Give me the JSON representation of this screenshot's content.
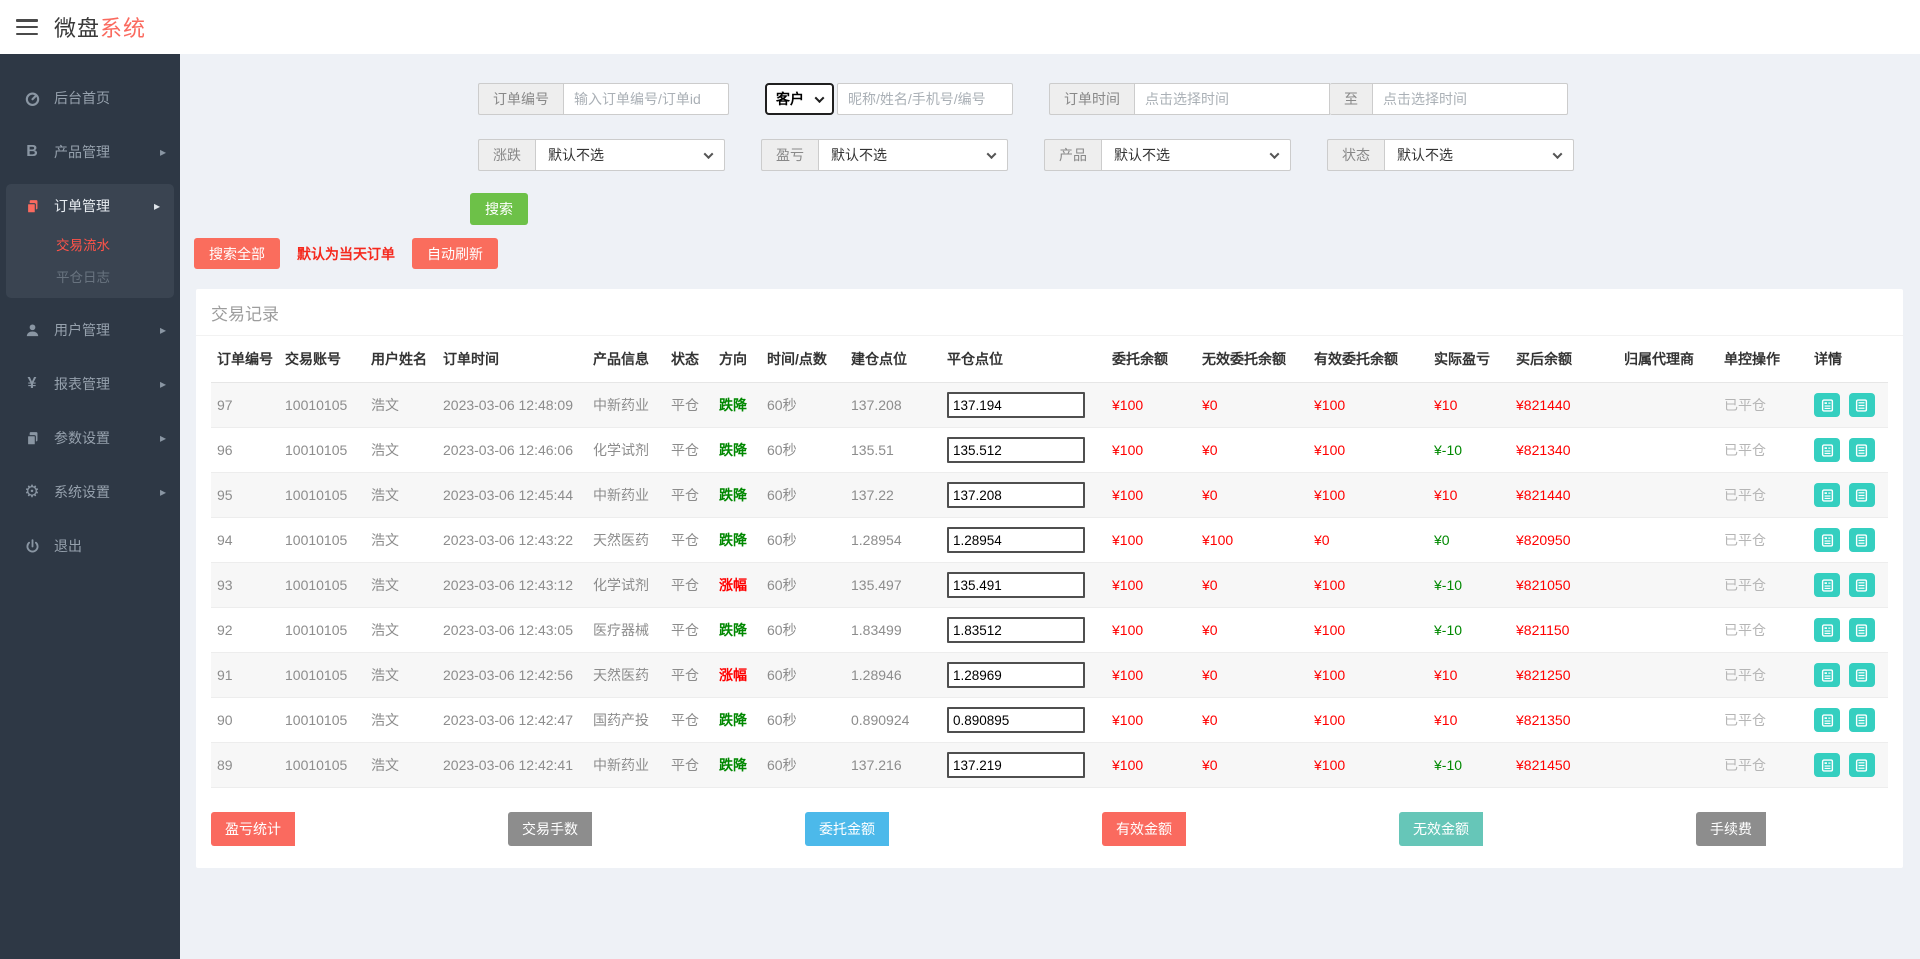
{
  "header": {
    "brand_black": "微盘",
    "brand_red": "系统"
  },
  "sidebar": {
    "home": "后台首页",
    "product": "产品管理",
    "order": "订单管理",
    "flow": "交易流水",
    "log": "平仓日志",
    "user": "用户管理",
    "report": "报表管理",
    "param": "参数设置",
    "system": "系统设置",
    "logout": "退出"
  },
  "filters": {
    "order_no_label": "订单编号",
    "order_no_placeholder": "输入订单编号/订单id",
    "customer_select": "客户",
    "customer_placeholder": "昵称/姓名/手机号/编号",
    "time_label": "订单时间",
    "time_placeholder": "点击选择时间",
    "to_label": "至",
    "time_placeholder2": "点击选择时间",
    "updown_label": "涨跌",
    "updown_value": "默认不选",
    "pl_label": "盈亏",
    "pl_value": "默认不选",
    "product_label": "产品",
    "product_value": "默认不选",
    "status_label": "状态",
    "status_value": "默认不选",
    "search_button": "搜索"
  },
  "actions": {
    "search_all": "搜索全部",
    "note": "默认为当天订单",
    "auto_refresh": "自动刷新"
  },
  "colors": {
    "accent_salmon": "#fa6a5f",
    "search_green": "#6dc148",
    "detail_teal": "#35cfc0",
    "money_red": "#ff0000",
    "money_green": "#008800"
  },
  "table": {
    "title": "交易记录",
    "columns": [
      "订单编号",
      "交易账号",
      "用户姓名",
      "订单时间",
      "产品信息",
      "状态",
      "方向",
      "时间/点数",
      "建仓点位",
      "平仓点位",
      "委托余额",
      "无效委托余额",
      "有效委托余额",
      "实际盈亏",
      "买后余额",
      "归属代理商",
      "单控操作",
      "详情"
    ],
    "rows": [
      {
        "no": "97",
        "account": "10010105",
        "name": "浩文",
        "time": "2023-03-06 12:48:09",
        "product": "中新药业",
        "status": "平仓",
        "direction": "跌降",
        "dir_cls": "green",
        "duration": "60秒",
        "open": "137.208",
        "close": "137.194",
        "entrust": "¥100",
        "invalid": "¥0",
        "valid": "¥100",
        "profit": "¥10",
        "profit_cls": "red",
        "after": "¥821440",
        "agent": "",
        "control": "已平仓"
      },
      {
        "no": "96",
        "account": "10010105",
        "name": "浩文",
        "time": "2023-03-06 12:46:06",
        "product": "化学试剂",
        "status": "平仓",
        "direction": "跌降",
        "dir_cls": "green",
        "duration": "60秒",
        "open": "135.51",
        "close": "135.512",
        "entrust": "¥100",
        "invalid": "¥0",
        "valid": "¥100",
        "profit": "¥-10",
        "profit_cls": "green",
        "after": "¥821340",
        "agent": "",
        "control": "已平仓"
      },
      {
        "no": "95",
        "account": "10010105",
        "name": "浩文",
        "time": "2023-03-06 12:45:44",
        "product": "中新药业",
        "status": "平仓",
        "direction": "跌降",
        "dir_cls": "green",
        "duration": "60秒",
        "open": "137.22",
        "close": "137.208",
        "entrust": "¥100",
        "invalid": "¥0",
        "valid": "¥100",
        "profit": "¥10",
        "profit_cls": "red",
        "after": "¥821440",
        "agent": "",
        "control": "已平仓"
      },
      {
        "no": "94",
        "account": "10010105",
        "name": "浩文",
        "time": "2023-03-06 12:43:22",
        "product": "天然医药",
        "status": "平仓",
        "direction": "跌降",
        "dir_cls": "green",
        "duration": "60秒",
        "open": "1.28954",
        "close": "1.28954",
        "entrust": "¥100",
        "invalid": "¥100",
        "valid": "¥0",
        "profit": "¥0",
        "profit_cls": "green",
        "after": "¥820950",
        "agent": "",
        "control": "已平仓"
      },
      {
        "no": "93",
        "account": "10010105",
        "name": "浩文",
        "time": "2023-03-06 12:43:12",
        "product": "化学试剂",
        "status": "平仓",
        "direction": "涨幅",
        "dir_cls": "red",
        "duration": "60秒",
        "open": "135.497",
        "close": "135.491",
        "entrust": "¥100",
        "invalid": "¥0",
        "valid": "¥100",
        "profit": "¥-10",
        "profit_cls": "green",
        "after": "¥821050",
        "agent": "",
        "control": "已平仓"
      },
      {
        "no": "92",
        "account": "10010105",
        "name": "浩文",
        "time": "2023-03-06 12:43:05",
        "product": "医疗器械",
        "status": "平仓",
        "direction": "跌降",
        "dir_cls": "green",
        "duration": "60秒",
        "open": "1.83499",
        "close": "1.83512",
        "entrust": "¥100",
        "invalid": "¥0",
        "valid": "¥100",
        "profit": "¥-10",
        "profit_cls": "green",
        "after": "¥821150",
        "agent": "",
        "control": "已平仓"
      },
      {
        "no": "91",
        "account": "10010105",
        "name": "浩文",
        "time": "2023-03-06 12:42:56",
        "product": "天然医药",
        "status": "平仓",
        "direction": "涨幅",
        "dir_cls": "red",
        "duration": "60秒",
        "open": "1.28946",
        "close": "1.28969",
        "entrust": "¥100",
        "invalid": "¥0",
        "valid": "¥100",
        "profit": "¥10",
        "profit_cls": "red",
        "after": "¥821250",
        "agent": "",
        "control": "已平仓"
      },
      {
        "no": "90",
        "account": "10010105",
        "name": "浩文",
        "time": "2023-03-06 12:42:47",
        "product": "国药产投",
        "status": "平仓",
        "direction": "跌降",
        "dir_cls": "green",
        "duration": "60秒",
        "open": "0.890924",
        "close": "0.890895",
        "entrust": "¥100",
        "invalid": "¥0",
        "valid": "¥100",
        "profit": "¥10",
        "profit_cls": "red",
        "after": "¥821350",
        "agent": "",
        "control": "已平仓"
      },
      {
        "no": "89",
        "account": "10010105",
        "name": "浩文",
        "time": "2023-03-06 12:42:41",
        "product": "中新药业",
        "status": "平仓",
        "direction": "跌降",
        "dir_cls": "green",
        "duration": "60秒",
        "open": "137.216",
        "close": "137.219",
        "entrust": "¥100",
        "invalid": "¥0",
        "valid": "¥100",
        "profit": "¥-10",
        "profit_cls": "green",
        "after": "¥821450",
        "agent": "",
        "control": "已平仓"
      }
    ]
  },
  "summary": {
    "items": [
      {
        "label": "盈亏统计",
        "color": "#fa6a5f"
      },
      {
        "label": "交易手数",
        "color": "#8d8d8d"
      },
      {
        "label": "委托金额",
        "color": "#4cb9ea"
      },
      {
        "label": "有效金额",
        "color": "#fa6a5f"
      },
      {
        "label": "无效金额",
        "color": "#66c6b8"
      },
      {
        "label": "手续费",
        "color": "#8d8d8d"
      }
    ]
  }
}
